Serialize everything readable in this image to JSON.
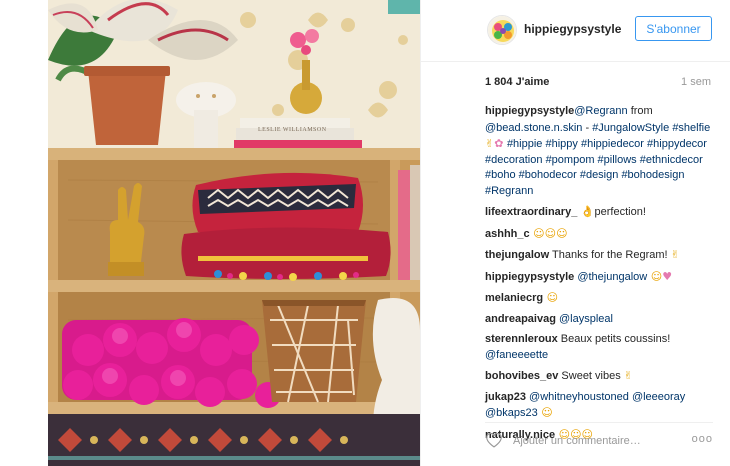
{
  "post": {
    "username": "hippiegypsystyle",
    "follow_label": "S'abonner",
    "likes": "1 804 J'aime",
    "time": "1 sem",
    "photo_lettering": {
      "book_label": "LESLIE WILLIAMSON"
    }
  },
  "comments": [
    {
      "user": "hippiegypsystyle",
      "parts": [
        {
          "t": "tag",
          "v": "@Regrann"
        },
        {
          "t": "text",
          "v": " from "
        },
        {
          "t": "tag",
          "v": "@bead.stone.n.skin"
        },
        {
          "t": "text",
          "v": " - "
        },
        {
          "t": "tag",
          "v": "#JungalowStyle"
        },
        {
          "t": "text",
          "v": " "
        },
        {
          "t": "tag",
          "v": "#shelfie"
        },
        {
          "t": "emoji-hand",
          "v": " ✌"
        },
        {
          "t": "emoji-pink",
          "v": "✿ "
        },
        {
          "t": "tag",
          "v": "#hippie"
        },
        {
          "t": "text",
          "v": " "
        },
        {
          "t": "tag",
          "v": "#hippy"
        },
        {
          "t": "text",
          "v": " "
        },
        {
          "t": "tag",
          "v": "#hippiedecor"
        },
        {
          "t": "text",
          "v": " "
        },
        {
          "t": "tag",
          "v": "#hippydecor"
        },
        {
          "t": "text",
          "v": " "
        },
        {
          "t": "tag",
          "v": "#decoration"
        },
        {
          "t": "text",
          "v": " "
        },
        {
          "t": "tag",
          "v": "#pompom"
        },
        {
          "t": "text",
          "v": " "
        },
        {
          "t": "tag",
          "v": "#pillows"
        },
        {
          "t": "text",
          "v": " "
        },
        {
          "t": "tag",
          "v": "#ethnicdecor"
        },
        {
          "t": "text",
          "v": " "
        },
        {
          "t": "tag",
          "v": "#boho"
        },
        {
          "t": "text",
          "v": " "
        },
        {
          "t": "tag",
          "v": "#bohodecor"
        },
        {
          "t": "text",
          "v": " "
        },
        {
          "t": "tag",
          "v": "#design"
        },
        {
          "t": "text",
          "v": " "
        },
        {
          "t": "tag",
          "v": "#bohodesign"
        },
        {
          "t": "text",
          "v": " "
        },
        {
          "t": "tag",
          "v": "#Regrann"
        }
      ]
    },
    {
      "user": "lifeextraordinary_",
      "parts": [
        {
          "t": "emoji-hand",
          "v": " 👌"
        },
        {
          "t": "text",
          "v": "perfection!"
        }
      ]
    },
    {
      "user": "ashhh_c",
      "parts": [
        {
          "t": "emoji-smile",
          "v": " ☺☺☺"
        }
      ]
    },
    {
      "user": "thejungalow",
      "parts": [
        {
          "t": "text",
          "v": " Thanks for the Regram! "
        },
        {
          "t": "emoji-hand",
          "v": "✌"
        }
      ]
    },
    {
      "user": "hippiegypsystyle",
      "parts": [
        {
          "t": "text",
          "v": " "
        },
        {
          "t": "tag",
          "v": "@thejungalow"
        },
        {
          "t": "emoji-smile",
          "v": " ☺"
        },
        {
          "t": "emoji-pink",
          "v": "♥"
        }
      ]
    },
    {
      "user": "melaniecrg",
      "parts": [
        {
          "t": "emoji-smile",
          "v": " ☺"
        }
      ]
    },
    {
      "user": "andreapaivag",
      "parts": [
        {
          "t": "text",
          "v": " "
        },
        {
          "t": "tag",
          "v": "@layspleal"
        }
      ]
    },
    {
      "user": "sterennleroux",
      "parts": [
        {
          "t": "text",
          "v": " Beaux petits coussins! "
        },
        {
          "t": "tag",
          "v": "@faneeeette"
        }
      ]
    },
    {
      "user": "bohovibes_ev",
      "parts": [
        {
          "t": "text",
          "v": " Sweet vibes "
        },
        {
          "t": "emoji-hand",
          "v": "✌"
        }
      ]
    },
    {
      "user": "jukap23",
      "parts": [
        {
          "t": "text",
          "v": " "
        },
        {
          "t": "tag",
          "v": "@whitneyhoustoned"
        },
        {
          "t": "text",
          "v": " "
        },
        {
          "t": "tag",
          "v": "@leeeoray"
        },
        {
          "t": "text",
          "v": " "
        },
        {
          "t": "tag",
          "v": "@bkaps23"
        },
        {
          "t": "emoji-smile",
          "v": " ☺"
        }
      ]
    },
    {
      "user": "naturally.nice",
      "parts": [
        {
          "t": "emoji-smile",
          "v": " ☺☺☺"
        }
      ]
    }
  ],
  "footer": {
    "placeholder": "Ajouter un commentaire…",
    "more_label": "ooo"
  },
  "colors": {
    "link": "#003569",
    "follow": "#3897f0",
    "muted": "#999999",
    "pompom": "#e8209a"
  },
  "icons": {
    "heart": "heart-outline-icon",
    "more": "more-options-icon"
  }
}
